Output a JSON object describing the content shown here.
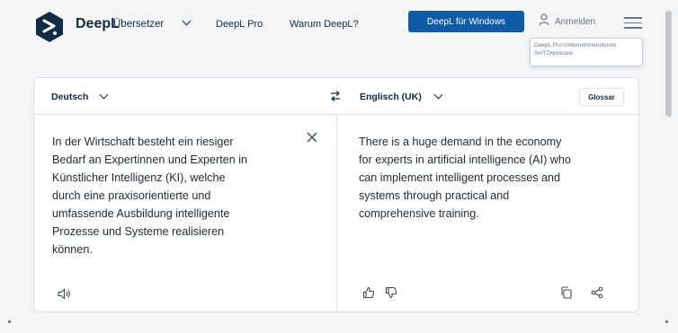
{
  "header": {
    "brand": "DeepL",
    "brand_sub": "Übersetzer",
    "nav": {
      "pro": "DeepL Pro",
      "why": "Warum DeepL?"
    },
    "cta": "DeepL für Windows",
    "signin": "Anmelden",
    "tooltip": [
      "DeepL Pro-Unternehmenskonto",
      "SmTO•procure"
    ]
  },
  "translator": {
    "source_lang": "Deutsch",
    "target_lang": "Englisch (UK)",
    "glossary": "Glossar",
    "source_text": "In der Wirtschaft besteht ein riesiger\nBedarf an Expertinnen und Experten in\nKünstlicher Intelligenz (KI), welche\ndurch eine praxisorientierte und\numfassende Ausbildung intelligente\nProzesse und Systeme realisieren\nkönnen.",
    "target_text": "There is a huge demand in the economy\nfor experts in artificial intelligence (AI) who\ncan implement intelligent processes and\nsystems through practical and\ncomprehensive training."
  },
  "colors": {
    "brand": "#0f2b46",
    "cta": "#0f5ba8",
    "background": "#f3f5f6"
  },
  "icons": [
    "deepl-logo-icon",
    "user-icon",
    "menu-icon",
    "swap-icon",
    "close-icon",
    "speaker-icon",
    "thumbs-up-icon",
    "thumbs-down-icon",
    "copy-icon",
    "share-icon"
  ]
}
